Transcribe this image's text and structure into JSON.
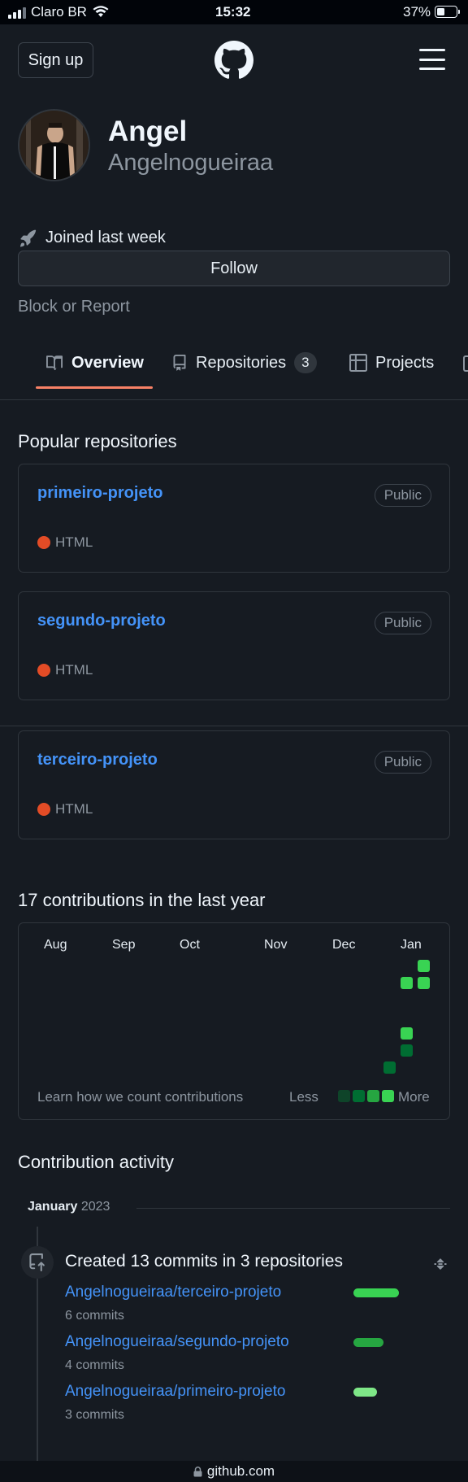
{
  "status_bar": {
    "carrier": "Claro BR",
    "time": "15:32",
    "battery": "37%"
  },
  "header": {
    "signup": "Sign up",
    "logo_icon": "github-mark-icon",
    "menu_icon": "hamburger-icon"
  },
  "profile": {
    "name": "Angel",
    "login": "Angelnogueiraa",
    "joined": "Joined last week",
    "follow": "Follow",
    "block": "Block or Report"
  },
  "tabs": [
    {
      "label": "Overview",
      "icon": "book-icon"
    },
    {
      "label": "Repositories",
      "icon": "repo-icon",
      "count": "3"
    },
    {
      "label": "Projects",
      "icon": "table-icon"
    }
  ],
  "popular": {
    "heading": "Popular repositories",
    "repos": [
      {
        "name": "primeiro-projeto",
        "visibility": "Public",
        "language": "HTML"
      },
      {
        "name": "segundo-projeto",
        "visibility": "Public",
        "language": "HTML"
      },
      {
        "name": "terceiro-projeto",
        "visibility": "Public",
        "language": "HTML"
      }
    ],
    "lang_color": "#e34c26"
  },
  "contributions": {
    "heading": "17 contributions in the last year",
    "months": [
      "Aug",
      "Sep",
      "Oct",
      "Nov",
      "Dec",
      "Jan"
    ],
    "learn": "Learn how we count contributions",
    "less": "Less",
    "more": "More"
  },
  "activity": {
    "heading": "Contribution activity",
    "month": "January",
    "year": "2023",
    "title": "Created 13 commits in 3 repositories",
    "items": [
      {
        "repo": "Angelnogueiraa/terceiro-projeto",
        "commits": "6 commits"
      },
      {
        "repo": "Angelnogueiraa/segundo-projeto",
        "commits": "4 commits"
      },
      {
        "repo": "Angelnogueiraa/primeiro-projeto",
        "commits": "3 commits"
      }
    ]
  },
  "url": "github.com"
}
